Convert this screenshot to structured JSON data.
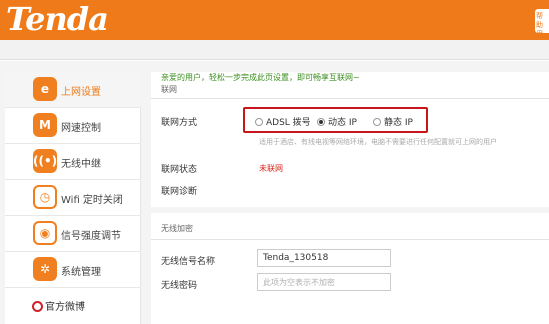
{
  "header": {
    "logo": "Tenda",
    "help_label": "帮助 用户"
  },
  "sidebar": {
    "items": [
      {
        "label": "上网设置",
        "icon": "e-globe-icon"
      },
      {
        "label": "网速控制",
        "icon": "speed-m-icon"
      },
      {
        "label": "无线中继",
        "icon": "relay-icon"
      },
      {
        "label": "Wifi 定时关闭",
        "icon": "timer-icon"
      },
      {
        "label": "信号强度调节",
        "icon": "signal-icon"
      },
      {
        "label": "系统管理",
        "icon": "gear-icon"
      }
    ],
    "weibo_label": "官方微博"
  },
  "main": {
    "welcome": "亲爱的用户，轻松一步完成此页设置，即可畅享互联网~",
    "internet": {
      "section_title": "联网",
      "mode_label": "联网方式",
      "modes": [
        {
          "label": "ADSL 拨号",
          "checked": false
        },
        {
          "label": "动态 IP",
          "checked": true
        },
        {
          "label": "静态 IP",
          "checked": false
        }
      ],
      "hint": "适用于酒店、有线电视等网络环境，电脑不需要进行任何配置就可上网的用户",
      "status_label": "联网状态",
      "status_value": "未联网",
      "diag_label": "联网诊断"
    },
    "wireless": {
      "section_title": "无线加密",
      "ssid_label": "无线信号名称",
      "ssid_value": "Tenda_130518",
      "password_label": "无线密码",
      "password_placeholder": "此项为空表示不加密"
    }
  },
  "colors": {
    "brand_orange": "#ee7a1a",
    "highlight_red": "#c4161c",
    "status_red": "#d9261c",
    "welcome_green": "#3a8e1f"
  }
}
